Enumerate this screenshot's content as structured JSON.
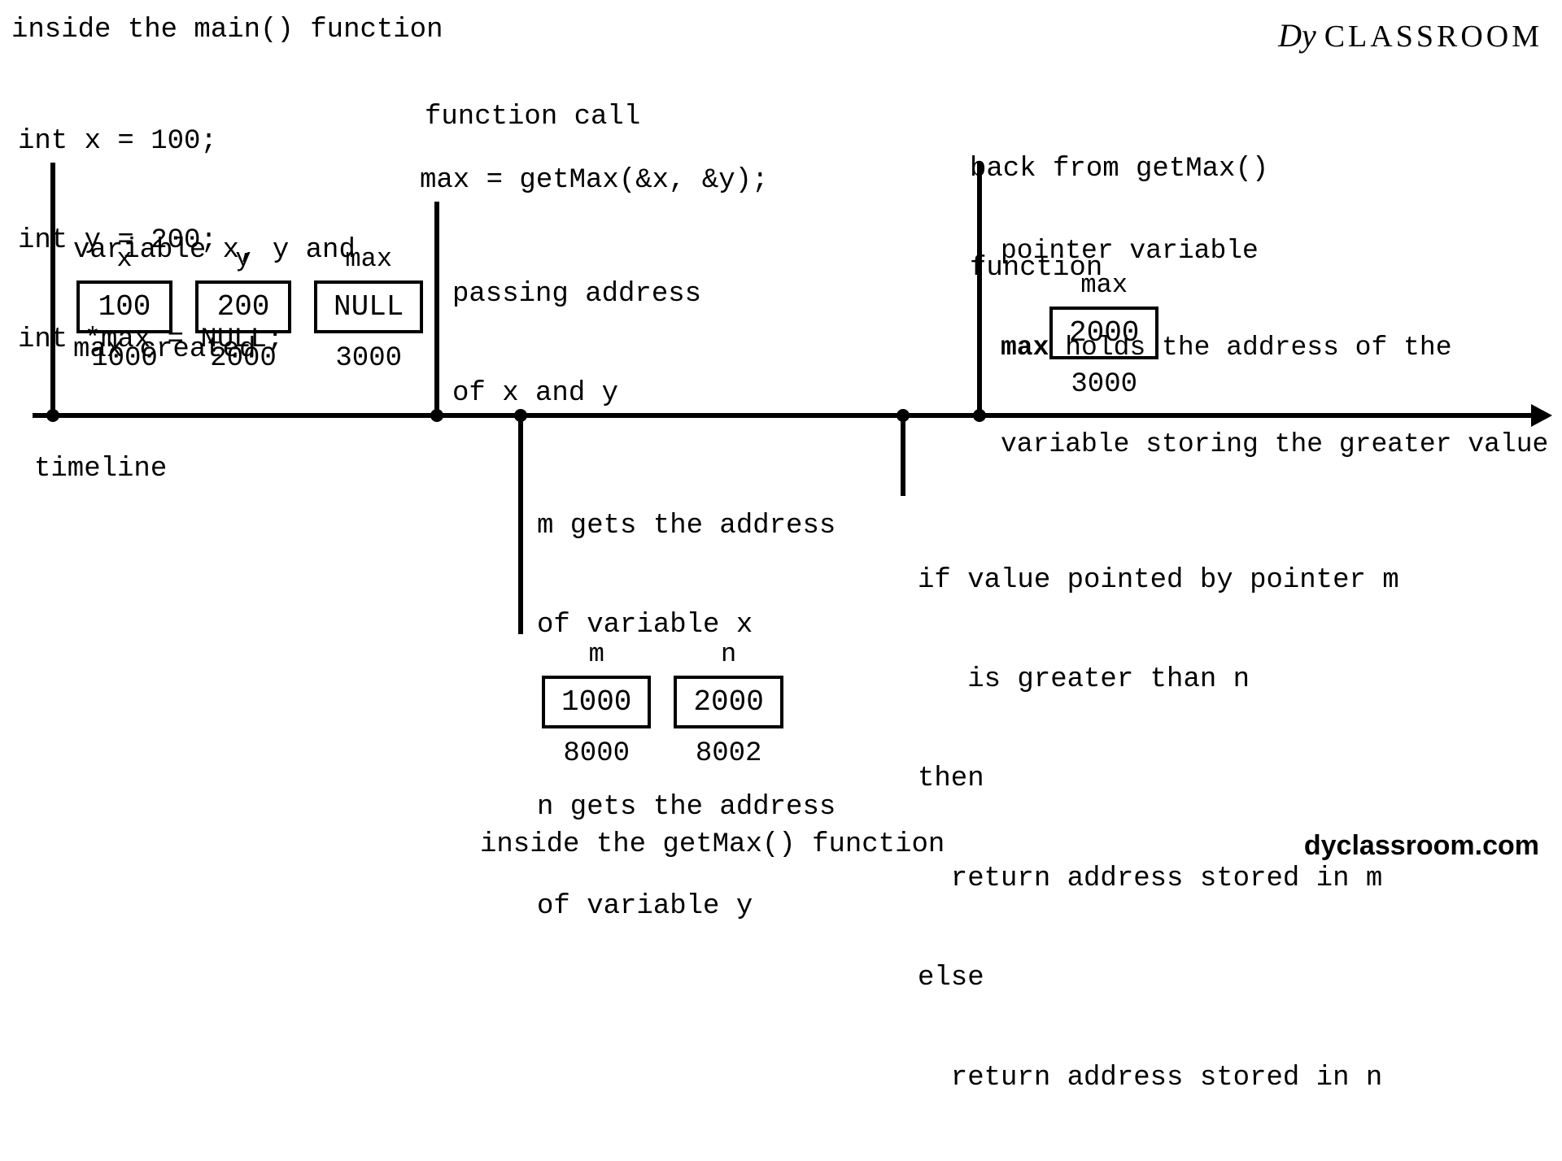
{
  "header": {
    "brand_prefix": "Dy",
    "brand_word": "CLASSROOM"
  },
  "top": {
    "section_title": "inside the main() function",
    "code_line1": "int x = 100;",
    "code_line2": "int y = 200;",
    "code_line3": "int *max = NULL;"
  },
  "stage1": {
    "note_line1": "variable x, y and",
    "note_line2": "max created",
    "cells": {
      "x": {
        "name": "x",
        "value": "100",
        "addr": "1000"
      },
      "y": {
        "name": "y",
        "value": "200",
        "addr": "2000"
      },
      "max": {
        "name": "max",
        "value": "NULL",
        "addr": "3000"
      }
    }
  },
  "stage2": {
    "heading": "function call",
    "call_expr": "max = getMax(&x, &y);",
    "note_line1": "passing address",
    "note_line2": "of x and y"
  },
  "stage3_below": {
    "note_line1": "m gets the address",
    "note_line2": "of variable x",
    "note_line3": "n gets the address",
    "note_line4": "of variable y",
    "cells": {
      "m": {
        "name": "m",
        "value": "1000",
        "addr": "8000"
      },
      "n": {
        "name": "n",
        "value": "2000",
        "addr": "8002"
      }
    }
  },
  "stage4_below": {
    "line1": "if value pointed by pointer m",
    "line2": "   is greater than n",
    "line3": "then",
    "line4": "  return address stored in m",
    "line5": "else",
    "line6": "  return address stored in n"
  },
  "stage5": {
    "heading_line1": "back from getMax()",
    "heading_line2": "function",
    "note_line1": "pointer variable",
    "note_line2_prefix": "max",
    "note_line2_rest": " holds the address of the",
    "note_line3": "variable storing the greater value",
    "cell": {
      "name": "max",
      "value": "2000",
      "addr": "3000"
    }
  },
  "labels": {
    "timeline": "timeline",
    "inside_getmax": "inside the getMax() function"
  },
  "footer": {
    "brand": "dyclassroom.com"
  }
}
